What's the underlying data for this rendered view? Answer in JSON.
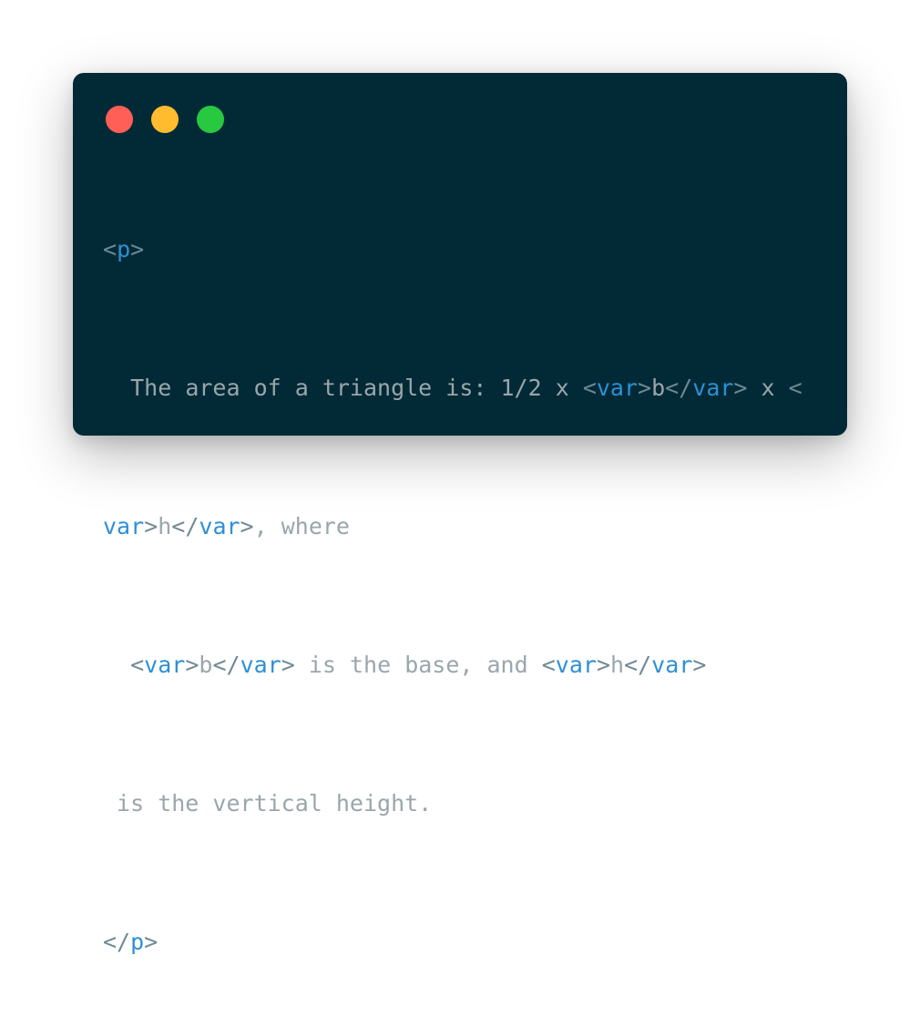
{
  "window": {
    "traffic_lights": [
      {
        "name": "close",
        "color": "#ff5f57"
      },
      {
        "name": "minimize",
        "color": "#febc2e"
      },
      {
        "name": "zoom",
        "color": "#28c840"
      }
    ]
  },
  "code": {
    "colors": {
      "tag": "#2f8fd6",
      "punctuation": "#6e8a94",
      "text": "#9aa6ab"
    },
    "line1": {
      "open": "<",
      "tag": "p",
      "close": ">"
    },
    "line2": {
      "indent": "  ",
      "text1": "The area of a triangle is: 1/2 x ",
      "lt1": "<",
      "tag1": "var",
      "gt1": ">",
      "text2": "b",
      "lt2": "</",
      "tag2": "var",
      "gt2": ">",
      "text3": " x ",
      "lt3": "<"
    },
    "line3": {
      "tag1": "var",
      "gt1": ">",
      "text1": "h",
      "lt2": "</",
      "tag2": "var",
      "gt2": ">",
      "text2": ", where"
    },
    "line4": {
      "indent": "  ",
      "lt1": "<",
      "tag1": "var",
      "gt1": ">",
      "text1": "b",
      "lt2": "</",
      "tag2": "var",
      "gt2": ">",
      "text2": " is the base, and ",
      "lt3": "<",
      "tag3": "var",
      "gt3": ">",
      "text3": "h",
      "lt4": "</",
      "tag4": "var",
      "gt4": ">"
    },
    "line5": {
      "text": " is the vertical height."
    },
    "line6": {
      "open": "</",
      "tag": "p",
      "close": ">"
    }
  }
}
